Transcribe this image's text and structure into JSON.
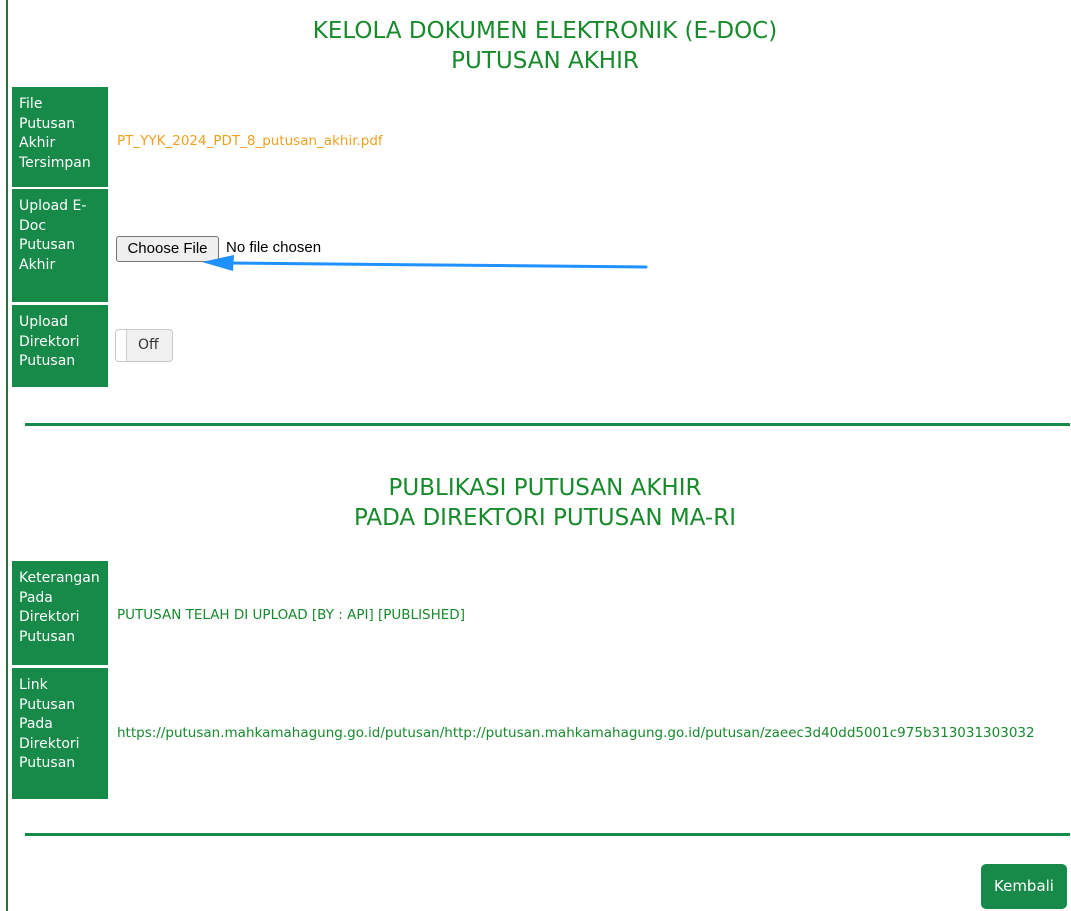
{
  "section1": {
    "heading_line1": "KELOLA DOKUMEN ELEKTRONIK (E-DOC)",
    "heading_line2": "PUTUSAN AKHIR"
  },
  "rows": {
    "file_tersimpan": {
      "label": [
        "File",
        "Putusan",
        "Akhir",
        "Tersimpan"
      ],
      "value": "PT_YYK_2024_PDT_8_putusan_akhir.pdf"
    },
    "upload_edoc": {
      "label": [
        "Upload E-",
        "Doc",
        "Putusan",
        "Akhir"
      ],
      "button_label": "Choose File",
      "status_text": "No file chosen"
    },
    "upload_direktori": {
      "label": [
        "Upload",
        "Direktori",
        "Putusan"
      ],
      "toggle_label": "Off"
    }
  },
  "section2": {
    "heading_line1": "PUBLIKASI PUTUSAN AKHIR",
    "heading_line2": "PADA DIREKTORI PUTUSAN MA-RI"
  },
  "rows2": {
    "keterangan": {
      "label": [
        "Keterangan",
        "Pada",
        "Direktori",
        "Putusan"
      ],
      "value": "PUTUSAN TELAH DI UPLOAD [BY : API] [PUBLISHED]"
    },
    "link": {
      "label": [
        "Link",
        "Putusan",
        "Pada",
        "Direktori",
        "Putusan"
      ],
      "value": "https://putusan.mahkamahagung.go.id/putusan/http://putusan.mahkamahagung.go.id/putusan/zaeec3d40dd5001c975b313031303032"
    }
  },
  "footer": {
    "back_label": "Kembali"
  },
  "colors": {
    "green": "#178a49",
    "heading_green": "#178a2c",
    "orange": "#f0a020",
    "arrow_blue": "#1e90ff"
  },
  "icons": {
    "annotation": "arrow-left-icon"
  }
}
